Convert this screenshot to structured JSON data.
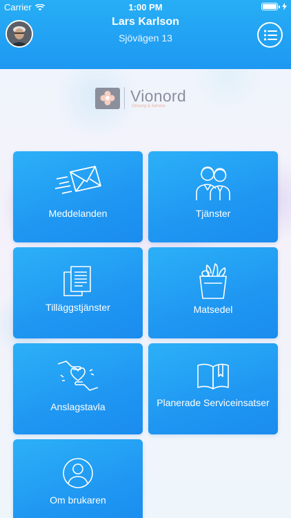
{
  "status_bar": {
    "carrier": "Carrier",
    "time": "1:00 PM"
  },
  "header": {
    "user_name": "Lars Karlson",
    "address": "Sjövägen 13",
    "menu_icon": "list-menu-icon",
    "avatar_icon": "user-avatar"
  },
  "logo": {
    "name": "Vionord",
    "tagline": "Omsorg & Service"
  },
  "tiles": [
    {
      "label": "Meddelanden",
      "icon": "envelope-icon"
    },
    {
      "label": "Tjänster",
      "icon": "people-icon"
    },
    {
      "label": "Tilläggstjänster",
      "icon": "documents-icon"
    },
    {
      "label": "Matsedel",
      "icon": "grocery-bag-icon"
    },
    {
      "label": "Anslagstavla",
      "icon": "hands-heart-icon"
    },
    {
      "label": "Planerade Serviceinsatser",
      "icon": "book-icon"
    },
    {
      "label": "Om brukaren",
      "icon": "person-icon"
    }
  ],
  "colors": {
    "header": "#1e98f2",
    "tile": "#2cb0f7",
    "logo_gray": "#8b8f9c",
    "logo_peach": "#e8b09c"
  }
}
